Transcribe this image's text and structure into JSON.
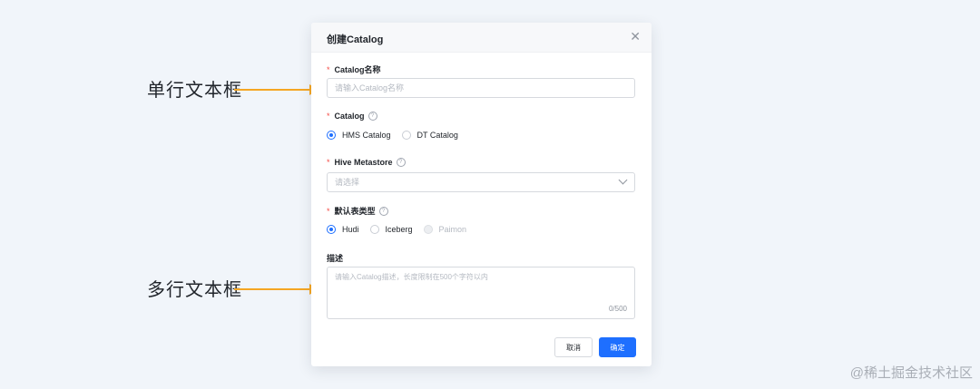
{
  "annotations": {
    "single_line": "单行文本框",
    "multi_line": "多行文本框"
  },
  "dialog": {
    "title": "创建Catalog",
    "close_icon": "close-icon",
    "fields": {
      "name": {
        "label": "Catalog名称",
        "placeholder": "请输入Catalog名称",
        "value": ""
      },
      "catalog": {
        "label": "Catalog",
        "options": [
          "HMS Catalog",
          "DT Catalog"
        ],
        "selected": "HMS Catalog"
      },
      "metastore": {
        "label": "Hive Metastore",
        "placeholder": "请选择"
      },
      "table_type": {
        "label": "默认表类型",
        "options": [
          "Hudi",
          "Iceberg",
          "Paimon"
        ],
        "selected": "Hudi",
        "disabled": [
          "Paimon"
        ]
      },
      "description": {
        "label": "描述",
        "placeholder": "请输入Catalog描述，长度限制在500个字符以内",
        "counter": "0/500"
      }
    },
    "buttons": {
      "cancel": "取消",
      "ok": "确定"
    }
  },
  "watermark": "@稀土掘金技术社区",
  "colors": {
    "accent": "#1e6fff",
    "required": "#f54a45",
    "arrow": "#f5a623"
  }
}
